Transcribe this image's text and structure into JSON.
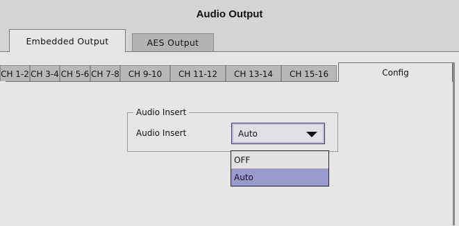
{
  "window": {
    "title": "Audio Output"
  },
  "outer_tabs": [
    {
      "label": "Embedded Output",
      "active": true
    },
    {
      "label": "AES Output",
      "active": false
    }
  ],
  "inner_tabs": [
    {
      "label": "CH 1-2",
      "active": false
    },
    {
      "label": "CH 3-4",
      "active": false
    },
    {
      "label": "CH 5-6",
      "active": false
    },
    {
      "label": "CH 7-8",
      "active": false
    },
    {
      "label": "CH 9-10",
      "active": false
    },
    {
      "label": "CH 11-12",
      "active": false
    },
    {
      "label": "CH 13-14",
      "active": false
    },
    {
      "label": "CH 15-16",
      "active": false
    },
    {
      "label": "Config",
      "active": true
    }
  ],
  "audio_insert_group": {
    "legend": "Audio Insert",
    "field_label": "Audio Insert",
    "selected_value": "Auto",
    "options": [
      {
        "label": "OFF",
        "highlighted": false
      },
      {
        "label": "Auto",
        "highlighted": true
      }
    ]
  },
  "colors": {
    "background": "#d4d4d4",
    "panel": "#e6e6e6",
    "highlight": "#9a9ad0"
  }
}
